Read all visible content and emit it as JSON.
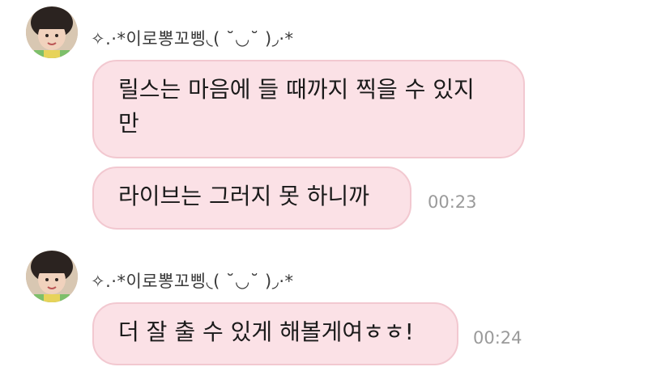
{
  "groups": [
    {
      "sender": "✧.·*이로뽕꼬삥◟( ˘◡˘ )◞·*",
      "messages": [
        {
          "line1": "릴스는 마음에 들 때까지 찍을 수 있지",
          "line2": "만",
          "time": ""
        },
        {
          "text": "라이브는 그러지 못 하니까",
          "time": "00:23"
        }
      ]
    },
    {
      "sender": "✧.·*이로뽕꼬삥◟( ˘◡˘ )◞·*",
      "messages": [
        {
          "text": "더 잘 출 수 있게 해볼게여ㅎㅎ!",
          "time": "00:24"
        }
      ]
    }
  ],
  "colors": {
    "bubble_bg": "#fbe1e6",
    "bubble_border": "#f2c8d0",
    "timestamp": "#9a9a9a"
  },
  "icons": {
    "avatar": "child-profile-photo"
  }
}
